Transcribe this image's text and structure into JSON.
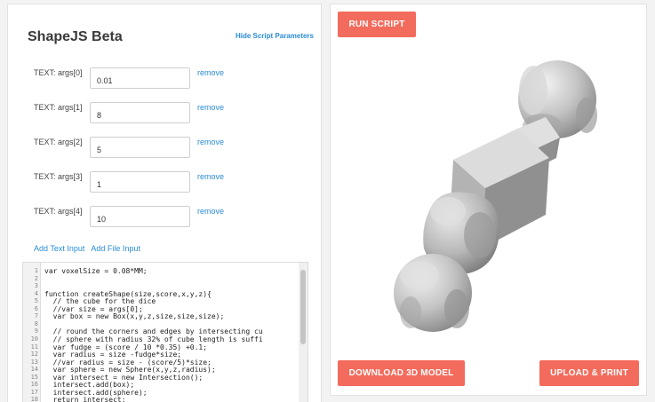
{
  "app": {
    "title": "ShapeJS Beta",
    "hide_params": "Hide Script Parameters"
  },
  "args": [
    {
      "label": "TEXT: args[0]",
      "value": "0.01",
      "remove": "remove"
    },
    {
      "label": "TEXT: args[1]",
      "value": "8",
      "remove": "remove"
    },
    {
      "label": "TEXT: args[2]",
      "value": "5",
      "remove": "remove"
    },
    {
      "label": "TEXT: args[3]",
      "value": "1",
      "remove": "remove"
    },
    {
      "label": "TEXT: args[4]",
      "value": "10",
      "remove": "remove"
    }
  ],
  "add_links": {
    "text_input": "Add Text Input",
    "file_input": "Add File Input"
  },
  "editor": {
    "lines": [
      {
        "n": "1",
        "code": "var voxelSize = 0.08*MM;"
      },
      {
        "n": "2",
        "code": ""
      },
      {
        "n": "3",
        "code": ""
      },
      {
        "n": "4",
        "code": "function createShape(size,score,x,y,z){"
      },
      {
        "n": "5",
        "code": "  // the cube for the dice"
      },
      {
        "n": "6",
        "code": "  //var size = args[0];"
      },
      {
        "n": "7",
        "code": "  var box = new Box(x,y,z,size,size,size);"
      },
      {
        "n": "8",
        "code": ""
      },
      {
        "n": "9",
        "code": "  // round the corners and edges by intersecting cu"
      },
      {
        "n": "10",
        "code": "  // sphere with radius 32% of cube length is suffi"
      },
      {
        "n": "11",
        "code": "  var fudge = (score / 10 *0.35) +0.1;"
      },
      {
        "n": "12",
        "code": "  var radius = size -fudge*size;"
      },
      {
        "n": "13",
        "code": "  //var radius = size - (score/5)*size;"
      },
      {
        "n": "14",
        "code": "  var sphere = new Sphere(x,y,z,radius);"
      },
      {
        "n": "15",
        "code": "  var intersect = new Intersection();"
      },
      {
        "n": "16",
        "code": "  intersect.add(box);"
      },
      {
        "n": "17",
        "code": "  intersect.add(sphere);"
      },
      {
        "n": "18",
        "code": "  return intersect;"
      }
    ]
  },
  "buttons": {
    "run": "RUN SCRIPT",
    "download": "DOWNLOAD 3D MODEL",
    "upload": "UPLOAD & PRINT"
  },
  "colors": {
    "accent": "#f36b5c",
    "link": "#2a8bd6",
    "model": "#b3b3b3"
  }
}
